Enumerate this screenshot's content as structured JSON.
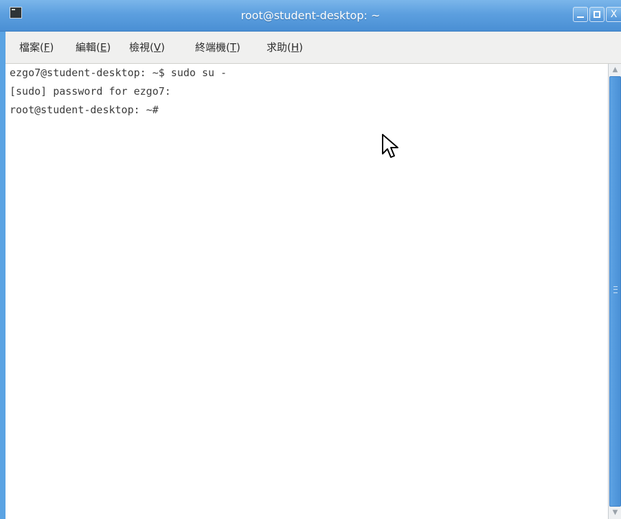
{
  "window": {
    "title": "root@student-desktop: ~",
    "icon": "terminal-icon",
    "controls": {
      "minimize": "minimize-icon",
      "maximize": "maximize-icon",
      "close_label": "X"
    }
  },
  "menubar": {
    "items": [
      {
        "label": "檔案(",
        "accel": "F",
        "tail": ")"
      },
      {
        "label": "編輯(",
        "accel": "E",
        "tail": ")"
      },
      {
        "label": "檢視(",
        "accel": "V",
        "tail": ")"
      },
      {
        "label": "終端機(",
        "accel": "T",
        "tail": ")"
      },
      {
        "label": "求助(",
        "accel": "H",
        "tail": ")"
      }
    ]
  },
  "terminal": {
    "lines": [
      "ezgo7@student-desktop: ~$ sudo su -",
      "[sudo] password for ezgo7:",
      "root@student-desktop: ~#"
    ]
  },
  "scrollbar": {
    "up": "▲",
    "down": "▼"
  },
  "colors": {
    "titlebar": "#5c9fdf",
    "menubar": "#f0f0ef",
    "terminal_bg": "#ffffff",
    "terminal_fg": "#3c3c3c"
  }
}
